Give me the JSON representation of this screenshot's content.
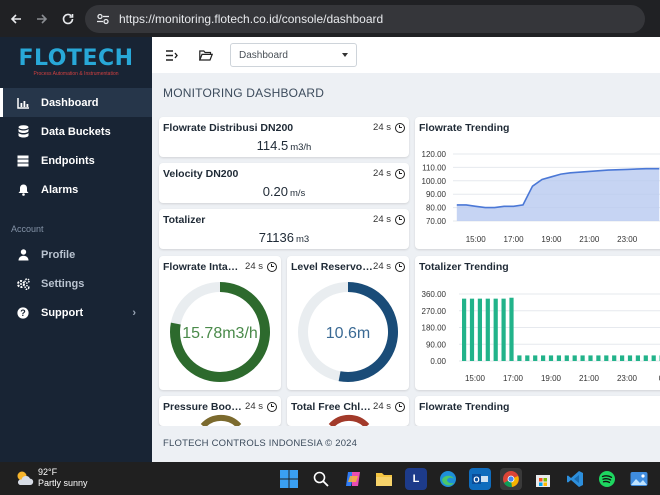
{
  "browser": {
    "url": "https://monitoring.flotech.co.id/console/dashboard"
  },
  "brand": {
    "logo_text": "FLOTECH",
    "logo_tagline": "Process Automation & Instrumentation"
  },
  "sidebar": {
    "items": [
      {
        "label": "Dashboard",
        "icon": "chart-icon"
      },
      {
        "label": "Data Buckets",
        "icon": "database-icon"
      },
      {
        "label": "Endpoints",
        "icon": "server-icon"
      },
      {
        "label": "Alarms",
        "icon": "bell-icon"
      }
    ],
    "section": "Account",
    "account_items": [
      {
        "label": "Profile",
        "icon": "user-icon"
      },
      {
        "label": "Settings",
        "icon": "gears-icon"
      },
      {
        "label": "Support",
        "icon": "question-icon"
      }
    ]
  },
  "topbar": {
    "dropdown_value": "Dashboard"
  },
  "page": {
    "title": "MONITORING DASHBOARD",
    "footer": "FLOTECH CONTROLS INDONESIA © 2024"
  },
  "cards": [
    {
      "title": "Flowrate Distribusi DN200",
      "time": "24 s",
      "value": "114.5",
      "unit": "m3/h"
    },
    {
      "title": "Velocity DN200",
      "time": "24 s",
      "value": "0.20",
      "unit": "m/s"
    },
    {
      "title": "Totalizer",
      "time": "24 s",
      "value": "71136",
      "unit": "m3"
    }
  ],
  "gauges": [
    {
      "title": "Flowrate Inta…",
      "time": "24 s",
      "value_text": "15.78m3/h",
      "fraction": 0.78,
      "color": "#2d6a2d"
    },
    {
      "title": "Level Reservo…",
      "time": "24 s",
      "value_text": "10.6m",
      "fraction": 0.53,
      "color": "#1a4c78"
    }
  ],
  "bottom_cards": [
    {
      "title": "Pressure Boo…",
      "time": "24 s"
    },
    {
      "title": "Total Free Chl…",
      "time": "24 s"
    },
    {
      "title": "Flowrate Trending"
    }
  ],
  "charts_titles": {
    "flow": "Flowrate Trending",
    "total": "Totalizer Trending"
  },
  "chart_data": [
    {
      "type": "area",
      "title": "Flowrate Trending",
      "x_ticks": [
        "15:00",
        "17:00",
        "19:00",
        "21:00",
        "23:00",
        "0"
      ],
      "y_ticks": [
        "120.00",
        "110.00",
        "100.00",
        "90.00",
        "80.00",
        "70.00"
      ],
      "ylim": [
        70,
        120
      ],
      "x": [
        14.0,
        14.5,
        15.0,
        15.5,
        16.0,
        16.5,
        17.0,
        17.5,
        18.0,
        18.5,
        19.0,
        19.5,
        20.0,
        21.0,
        22.0,
        23.0,
        24.0,
        24.7
      ],
      "values": [
        82,
        82,
        81,
        80,
        80,
        81,
        81,
        82,
        96,
        101,
        103,
        105,
        106,
        107,
        108,
        108.5,
        109,
        109
      ],
      "color": "#4b78d6"
    },
    {
      "type": "bar",
      "title": "Totalizer Trending",
      "x_ticks": [
        "15:00",
        "17:00",
        "19:00",
        "21:00",
        "23:00",
        "0"
      ],
      "y_ticks": [
        "360.00",
        "270.00",
        "180.00",
        "90.00",
        "0.00"
      ],
      "ylim": [
        0,
        360
      ],
      "values": [
        335,
        335,
        335,
        335,
        335,
        335,
        340,
        30,
        30,
        30,
        30,
        30,
        30,
        30,
        30,
        30,
        30,
        30,
        30,
        30,
        30,
        30,
        30,
        30,
        30,
        30
      ],
      "color": "#22b38a"
    }
  ],
  "taskbar": {
    "temp": "92°F",
    "weather": "Partly sunny"
  },
  "colors": {
    "sidebar_bg": "#182434",
    "accent": "#28a8d8"
  }
}
